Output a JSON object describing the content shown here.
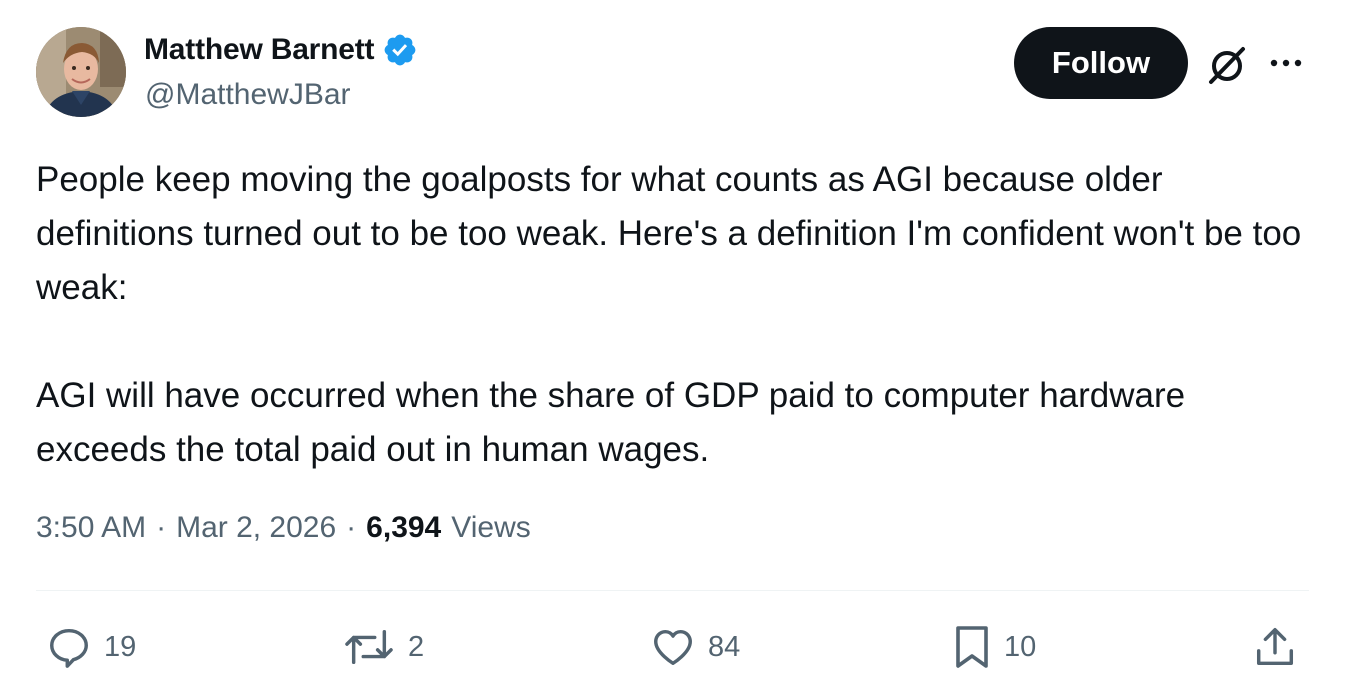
{
  "author": {
    "display_name": "Matthew Barnett",
    "handle": "@MatthewJBar",
    "verified_icon": "verified-badge-icon"
  },
  "header": {
    "follow_label": "Follow",
    "grok_icon": "grok-icon",
    "more_icon": "more-options-icon"
  },
  "tweet": {
    "paragraphs": [
      "People keep moving the goalposts for what counts as AGI because older definitions turned out to be too weak. Here's a definition I'm confident won't be too weak:",
      "AGI will have occurred when the share of GDP paid to computer hardware exceeds the total paid out in human wages."
    ]
  },
  "meta": {
    "time": "3:50 AM",
    "separator": "·",
    "date": "Mar 2, 2026",
    "views_count": "6,394",
    "views_label": "Views"
  },
  "actions": {
    "replies": "19",
    "reposts": "2",
    "likes": "84",
    "bookmarks": "10"
  },
  "colors": {
    "text_primary": "#0f1419",
    "text_secondary": "#536471",
    "follow_bg": "#0f1419",
    "verified_blue": "#1d9bf0",
    "divider": "#eff3f4"
  }
}
